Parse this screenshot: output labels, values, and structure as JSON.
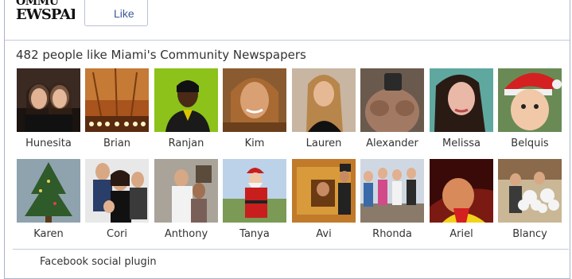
{
  "header": {
    "logo_top": "OMMU",
    "logo_bottom": "EWSPAI",
    "like_label": "Like"
  },
  "likes_title": "482 people like Miami's Community Newspapers",
  "fans": [
    {
      "name": "Hunesita"
    },
    {
      "name": "Brian"
    },
    {
      "name": "Ranjan"
    },
    {
      "name": "Kim"
    },
    {
      "name": "Lauren"
    },
    {
      "name": "Alexander"
    },
    {
      "name": "Melissa"
    },
    {
      "name": "Belquis"
    },
    {
      "name": "Karen"
    },
    {
      "name": "Cori"
    },
    {
      "name": "Anthony"
    },
    {
      "name": "Tanya"
    },
    {
      "name": "Avi"
    },
    {
      "name": "Rhonda"
    },
    {
      "name": "Ariel"
    },
    {
      "name": "Blancy"
    }
  ],
  "footer": {
    "text": "Facebook social plugin"
  }
}
